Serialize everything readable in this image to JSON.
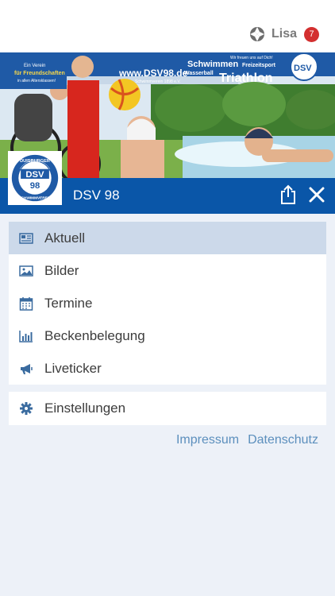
{
  "header": {
    "user_name": "Lisa",
    "notification_count": "7",
    "user_icon": "sports-ball-icon"
  },
  "banner": {
    "tagline_line1": "Ein Verein",
    "tagline_line2": "für Freundschaften",
    "tagline_line3": "in allen Altersklassen!",
    "website": "www.DSV98.de",
    "website_sub": "Schwimmverein 1898 e.V.",
    "slogan": "Wir freuen uns auf Dich!",
    "sport1": "Schwimmen",
    "sport2": "Freizeitsport",
    "sport3": "Wasserball",
    "sport4": "Triathlon"
  },
  "club": {
    "name": "DSV 98",
    "logo_top": "DUISBURGER",
    "logo_center": "DSV",
    "logo_number": "98",
    "logo_bottom": "SCHWIMMVEREIN"
  },
  "menu": {
    "items": [
      {
        "label": "Aktuell",
        "icon": "newspaper-icon",
        "active": true
      },
      {
        "label": "Bilder",
        "icon": "image-icon",
        "active": false
      },
      {
        "label": "Termine",
        "icon": "calendar-icon",
        "active": false
      },
      {
        "label": "Beckenbelegung",
        "icon": "bar-chart-icon",
        "active": false
      },
      {
        "label": "Liveticker",
        "icon": "megaphone-icon",
        "active": false
      }
    ]
  },
  "settings": {
    "label": "Einstellungen",
    "icon": "gear-icon"
  },
  "footer": {
    "impressum": "Impressum",
    "datenschutz": "Datenschutz"
  },
  "colors": {
    "brand_blue": "#0a56a8",
    "active_row": "#ccd9ea",
    "badge_red": "#d32f2f",
    "link": "#5c8fbd",
    "background": "#edf1f8"
  }
}
